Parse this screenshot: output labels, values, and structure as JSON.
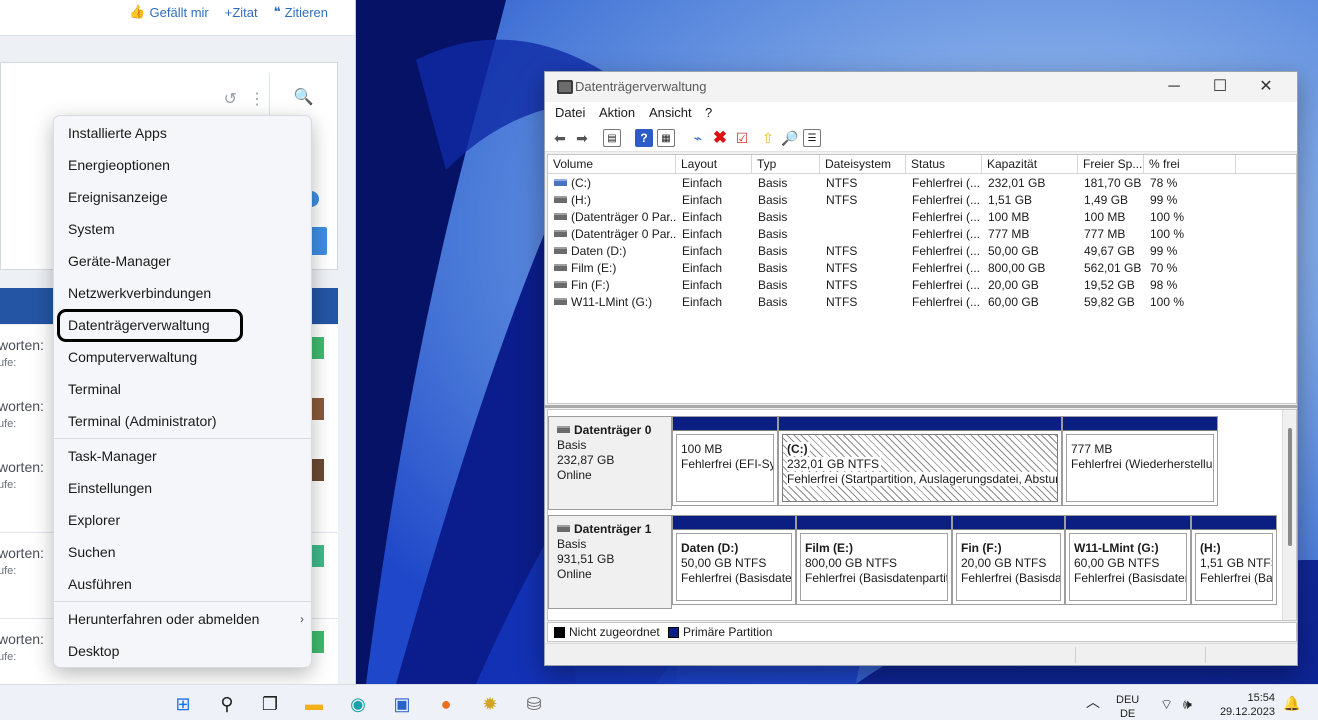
{
  "forum": {
    "actions": [
      {
        "icon": "thumbs-up-icon",
        "label": "Gefällt mir"
      },
      {
        "icon": "plus-icon",
        "label": "+Zitat"
      },
      {
        "icon": "quote-icon",
        "label": "Zitieren"
      }
    ],
    "rows": [
      {
        "t1": "worten:",
        "t2": "ufe:"
      },
      {
        "t1": "worten:",
        "t2": "ufe:"
      },
      {
        "t1": "worten:",
        "t2": "ufe:"
      },
      {
        "t1": "worten:",
        "t2": "ufe:"
      },
      {
        "t1": "worten:",
        "t2": "ufe:"
      }
    ]
  },
  "context_menu": {
    "group1": [
      "Installierte Apps",
      "Energieoptionen",
      "Ereignisanzeige",
      "System",
      "Geräte-Manager",
      "Netzwerkverbindungen",
      "Datenträgerverwaltung",
      "Computerverwaltung",
      "Terminal",
      "Terminal (Administrator)"
    ],
    "group2": [
      "Task-Manager",
      "Einstellungen",
      "Explorer",
      "Suchen",
      "Ausführen"
    ],
    "group3": [
      "Herunterfahren oder abmelden",
      "Desktop"
    ],
    "highlighted": "Datenträgerverwaltung"
  },
  "window": {
    "title": "Datenträgerverwaltung",
    "menu": [
      "Datei",
      "Aktion",
      "Ansicht",
      "?"
    ],
    "columns": [
      "Volume",
      "Layout",
      "Typ",
      "Dateisystem",
      "Status",
      "Kapazität",
      "Freier Sp...",
      "% frei"
    ],
    "volumes": [
      {
        "name": "(C:)",
        "layout": "Einfach",
        "type": "Basis",
        "fs": "NTFS",
        "status": "Fehlerfrei (...",
        "capacity": "232,01 GB",
        "free": "181,70 GB",
        "pct": "78 %"
      },
      {
        "name": "(H:)",
        "layout": "Einfach",
        "type": "Basis",
        "fs": "NTFS",
        "status": "Fehlerfrei (...",
        "capacity": "1,51 GB",
        "free": "1,49 GB",
        "pct": "99 %"
      },
      {
        "name": "(Datenträger 0 Par...",
        "layout": "Einfach",
        "type": "Basis",
        "fs": "",
        "status": "Fehlerfrei (...",
        "capacity": "100 MB",
        "free": "100 MB",
        "pct": "100 %"
      },
      {
        "name": "(Datenträger 0 Par...",
        "layout": "Einfach",
        "type": "Basis",
        "fs": "",
        "status": "Fehlerfrei (...",
        "capacity": "777 MB",
        "free": "777 MB",
        "pct": "100 %"
      },
      {
        "name": "Daten (D:)",
        "layout": "Einfach",
        "type": "Basis",
        "fs": "NTFS",
        "status": "Fehlerfrei (...",
        "capacity": "50,00 GB",
        "free": "49,67 GB",
        "pct": "99 %"
      },
      {
        "name": "Film (E:)",
        "layout": "Einfach",
        "type": "Basis",
        "fs": "NTFS",
        "status": "Fehlerfrei (...",
        "capacity": "800,00 GB",
        "free": "562,01 GB",
        "pct": "70 %"
      },
      {
        "name": "Fin (F:)",
        "layout": "Einfach",
        "type": "Basis",
        "fs": "NTFS",
        "status": "Fehlerfrei (...",
        "capacity": "20,00 GB",
        "free": "19,52 GB",
        "pct": "98 %"
      },
      {
        "name": "W11-LMint (G:)",
        "layout": "Einfach",
        "type": "Basis",
        "fs": "NTFS",
        "status": "Fehlerfrei (...",
        "capacity": "60,00 GB",
        "free": "59,82 GB",
        "pct": "100 %"
      }
    ],
    "disks": [
      {
        "name": "Datenträger 0",
        "type": "Basis",
        "size": "232,87 GB",
        "state": "Online",
        "partitions": [
          {
            "title": "",
            "line1": "100 MB",
            "line2": "Fehlerfrei (EFI-Sys"
          },
          {
            "title": "(C:)",
            "line1": "232,01 GB NTFS",
            "line2": "Fehlerfrei (Startpartition, Auslagerungsdatei, Absturz"
          },
          {
            "title": "",
            "line1": "777 MB",
            "line2": "Fehlerfrei (Wiederherstellu"
          }
        ]
      },
      {
        "name": "Datenträger 1",
        "type": "Basis",
        "size": "931,51 GB",
        "state": "Online",
        "partitions": [
          {
            "title": "Daten  (D:)",
            "line1": "50,00 GB NTFS",
            "line2": "Fehlerfrei (Basisdater"
          },
          {
            "title": "Film  (E:)",
            "line1": "800,00 GB NTFS",
            "line2": "Fehlerfrei (Basisdatenpartit"
          },
          {
            "title": "Fin  (F:)",
            "line1": "20,00 GB NTFS",
            "line2": "Fehlerfrei (Basisdat"
          },
          {
            "title": "W11-LMint  (G:)",
            "line1": "60,00 GB NTFS",
            "line2": "Fehlerfrei (Basisdater"
          },
          {
            "title": "(H:)",
            "line1": "1,51 GB NTFS",
            "line2": "Fehlerfrei (Ba"
          }
        ]
      }
    ],
    "legend": [
      {
        "color": "#000000",
        "label": "Nicht zugeordnet"
      },
      {
        "color": "#0b1f83",
        "label": "Primäre Partition"
      }
    ]
  },
  "taskbar": {
    "icons": [
      "windows-start-icon",
      "search-icon",
      "task-view-icon",
      "file-explorer-icon",
      "edge-browser-icon",
      "store-icon",
      "firefox-icon",
      "settings-app-icon",
      "disk-management-icon"
    ],
    "lang_top": "DEU",
    "lang_bottom": "DE",
    "time": "15:54",
    "date": "29.12.2023"
  }
}
